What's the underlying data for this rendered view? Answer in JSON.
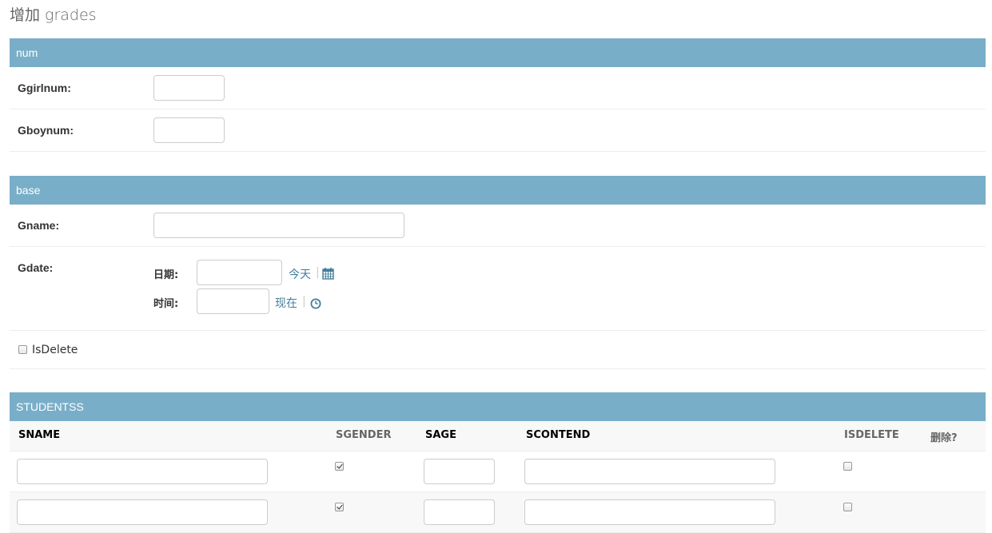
{
  "page": {
    "title": "增加 grades"
  },
  "fieldsets": {
    "num": {
      "title": "num",
      "fields": [
        {
          "label": "Ggirlnum:",
          "value": ""
        },
        {
          "label": "Gboynum:",
          "value": ""
        }
      ]
    },
    "base": {
      "title": "base",
      "gname": {
        "label": "Gname:",
        "value": ""
      },
      "gdate": {
        "label": "Gdate:",
        "date_label": "日期:",
        "date_value": "",
        "today_link": "今天",
        "separator": "|",
        "time_label": "时间:",
        "time_value": "",
        "now_link": "现在"
      },
      "isdelete": {
        "label": "IsDelete",
        "checked": false
      }
    }
  },
  "inline": {
    "title": "STUDENTSS",
    "columns": [
      "SNAME",
      "SGENDER",
      "SAGE",
      "SCONTEND",
      "ISDELETE",
      "删除?"
    ],
    "rows": [
      {
        "sname": "",
        "sgender": true,
        "sage": "",
        "scontend": "",
        "isdelete": false
      },
      {
        "sname": "",
        "sgender": true,
        "sage": "",
        "scontend": "",
        "isdelete": false
      }
    ]
  },
  "icons": {
    "calendar": "calendar-icon",
    "clock": "clock-icon"
  },
  "colors": {
    "header_bg": "#79aec8",
    "link": "#447e9b"
  }
}
